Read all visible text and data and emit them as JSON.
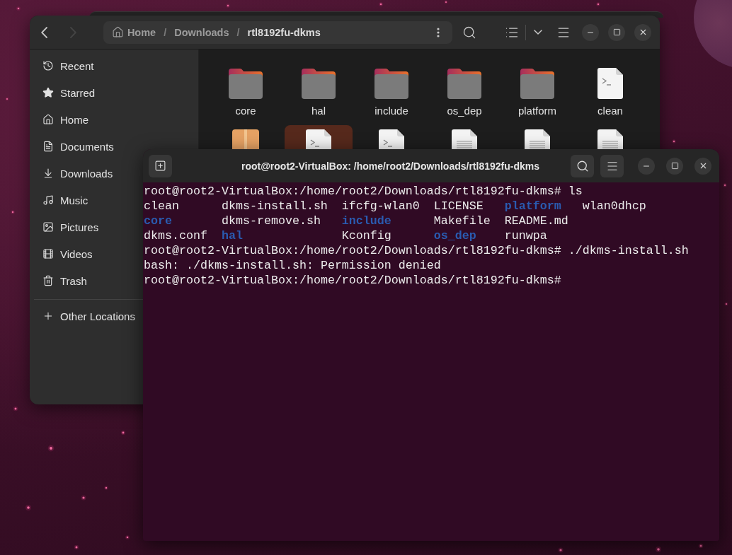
{
  "file_manager": {
    "nav": [
      {
        "kind": "back",
        "disabled": false
      },
      {
        "kind": "forward",
        "disabled": true
      }
    ],
    "path": [
      {
        "kind": "crumb",
        "label": "Home",
        "selected": false
      },
      {
        "kind": "separator",
        "label": "/"
      },
      {
        "kind": "crumb",
        "label": "Downloads",
        "selected": false
      },
      {
        "kind": "separator",
        "label": "/"
      },
      {
        "kind": "crumb",
        "label": "rtl8192fu-dkms",
        "selected": true
      }
    ],
    "sidebar": [
      {
        "kind": "place",
        "label": "Recent",
        "selected": false
      },
      {
        "kind": "place",
        "label": "Starred",
        "selected": false
      },
      {
        "kind": "place",
        "label": "Home",
        "selected": false
      },
      {
        "kind": "place",
        "label": "Documents",
        "selected": false
      },
      {
        "kind": "place",
        "label": "Downloads",
        "selected": false
      },
      {
        "kind": "place",
        "label": "Music",
        "selected": false
      },
      {
        "kind": "place",
        "label": "Pictures",
        "selected": false
      },
      {
        "kind": "place",
        "label": "Videos",
        "selected": false
      },
      {
        "kind": "place",
        "label": "Trash",
        "selected": false
      },
      {
        "kind": "other",
        "label": "Other Locations",
        "selected": false
      }
    ],
    "files": [
      {
        "kind": "folder",
        "name": "core",
        "selected": false
      },
      {
        "kind": "folder",
        "name": "hal",
        "selected": false
      },
      {
        "kind": "folder",
        "name": "include",
        "selected": false
      },
      {
        "kind": "folder",
        "name": "os_dep",
        "selected": false
      },
      {
        "kind": "folder",
        "name": "platform",
        "selected": false
      },
      {
        "kind": "script",
        "name": "clean",
        "selected": false
      },
      {
        "kind": "archive",
        "selected": false
      },
      {
        "kind": "script",
        "selected": true
      },
      {
        "kind": "script",
        "selected": false
      },
      {
        "kind": "text",
        "selected": false
      },
      {
        "kind": "text",
        "selected": false
      },
      {
        "kind": "text",
        "selected": false
      }
    ]
  },
  "terminal": {
    "title": "root@root2-VirtualBox: /home/root2/Downloads/rtl8192fu-dkms",
    "lines": [
      {
        "kind": "text",
        "text": "root@root2-VirtualBox:/home/root2/Downloads/rtl8192fu-dkms# ls"
      },
      {
        "kind": "listing",
        "rows": [
          [
            {
              "kind": "file",
              "name": "clean"
            },
            {
              "kind": "file",
              "name": "dkms-install.sh"
            },
            {
              "kind": "file",
              "name": "ifcfg-wlan0"
            },
            {
              "kind": "file",
              "name": "LICENSE"
            },
            {
              "kind": "dir",
              "name": "platform"
            },
            {
              "kind": "file",
              "name": "wlan0dhcp"
            }
          ],
          [
            {
              "kind": "dir",
              "name": "core"
            },
            {
              "kind": "file",
              "name": "dkms-remove.sh"
            },
            {
              "kind": "dir",
              "name": "include"
            },
            {
              "kind": "file",
              "name": "Makefile"
            },
            {
              "kind": "file",
              "name": "README.md"
            }
          ],
          [
            {
              "kind": "file",
              "name": "dkms.conf"
            },
            {
              "kind": "dir",
              "name": "hal"
            },
            {
              "kind": "file",
              "name": "Kconfig"
            },
            {
              "kind": "dir",
              "name": "os_dep"
            },
            {
              "kind": "file",
              "name": "runwpa"
            }
          ]
        ]
      },
      {
        "kind": "text",
        "text": "root@root2-VirtualBox:/home/root2/Downloads/rtl8192fu-dkms# ./dkms-install.sh"
      },
      {
        "kind": "text",
        "text": "bash: ./dkms-install.sh: Permission denied"
      },
      {
        "kind": "text",
        "text": "root@root2-VirtualBox:/home/root2/Downloads/rtl8192fu-dkms#"
      }
    ]
  }
}
